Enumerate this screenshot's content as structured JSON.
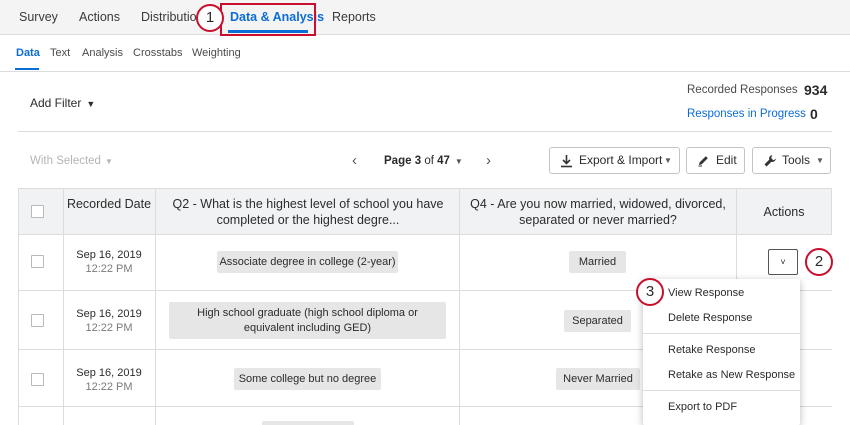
{
  "top_tabs": [
    "Survey",
    "Actions",
    "Distribution",
    "Data & Analysis",
    "Reports"
  ],
  "sub_tabs": [
    "Data",
    "Text",
    "Analysis",
    "Crosstabs",
    "Weighting"
  ],
  "step_labels": [
    "1",
    "2",
    "3"
  ],
  "filter": {
    "add_filter_label": "Add Filter"
  },
  "stats": {
    "recorded_label": "Recorded Responses",
    "recorded_value": "934",
    "in_progress_label": "Responses in Progress",
    "in_progress_value": "0"
  },
  "toolbar": {
    "with_selected": "With Selected",
    "page_prefix": "Page",
    "page_current": "3",
    "page_of": "of",
    "page_total": "47",
    "export_import": "Export & Import",
    "edit": "Edit",
    "tools": "Tools"
  },
  "table": {
    "headers": {
      "date": "Recorded Date",
      "q2": "Q2 - What is the highest level of school you have completed or the highest degre...",
      "q4": "Q4 - Are you now married, widowed, divorced, separated or never married?",
      "actions": "Actions"
    },
    "rows": [
      {
        "date": "Sep 16, 2019",
        "time": "12:22 PM",
        "q2": "Associate degree in college (2-year)",
        "q4": "Married"
      },
      {
        "date": "Sep 16, 2019",
        "time": "12:22 PM",
        "q2": "High school graduate (high school diploma or equivalent including GED)",
        "q4": "Separated"
      },
      {
        "date": "Sep 16, 2019",
        "time": "12:22 PM",
        "q2": "Some college but no degree",
        "q4": "Never Married"
      }
    ]
  },
  "menu": {
    "items": [
      "View Response",
      "Delete Response",
      "Retake Response",
      "Retake as New Response",
      "Export to PDF"
    ]
  },
  "colors": {
    "accent": "#0b6dd6",
    "annotation": "#c8102e",
    "header_bg": "#f1f2f4"
  }
}
